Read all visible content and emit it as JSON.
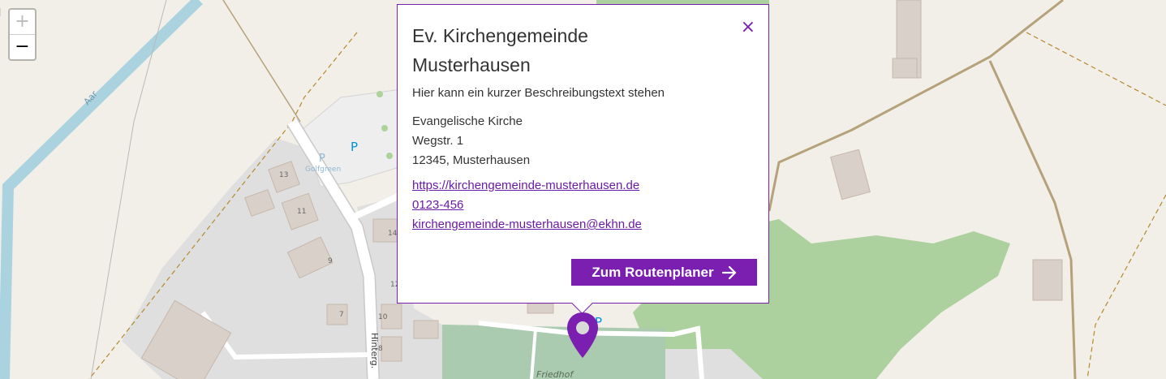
{
  "map": {
    "zoom_in": "+",
    "zoom_out": "−",
    "labels": {
      "river": "Aar",
      "street": "Hinterg.",
      "cemetery": "Friedhof",
      "parking_name": "Golfgreen",
      "parking_symbol": "P",
      "house_numbers": [
        "13",
        "11",
        "9",
        "7",
        "14",
        "12",
        "10",
        "8"
      ]
    },
    "colors": {
      "background": "#f2efe9",
      "residential": "#e0dfdf",
      "building": "#d9d0c9",
      "forest": "#add19e",
      "cemetery": "#aacbaf",
      "water": "#aad3df",
      "parking": "#eeeeee"
    }
  },
  "popup": {
    "title_line1": "Ev. Kirchengemeinde",
    "title_line2": "Musterhausen",
    "close_icon": "×",
    "description": "Hier kann ein kurzer Beschreibungstext stehen",
    "address": {
      "name": "Evangelische Kirche",
      "street": "Wegstr. 1",
      "city": "12345, Musterhausen"
    },
    "website": "https://kirchengemeinde-musterhausen.de",
    "phone": "0123-456",
    "email": "kirchengemeinde-musterhausen@ekhn.de",
    "route_button": "Zum Routenplaner",
    "accent_color": "#7a1fb0"
  }
}
